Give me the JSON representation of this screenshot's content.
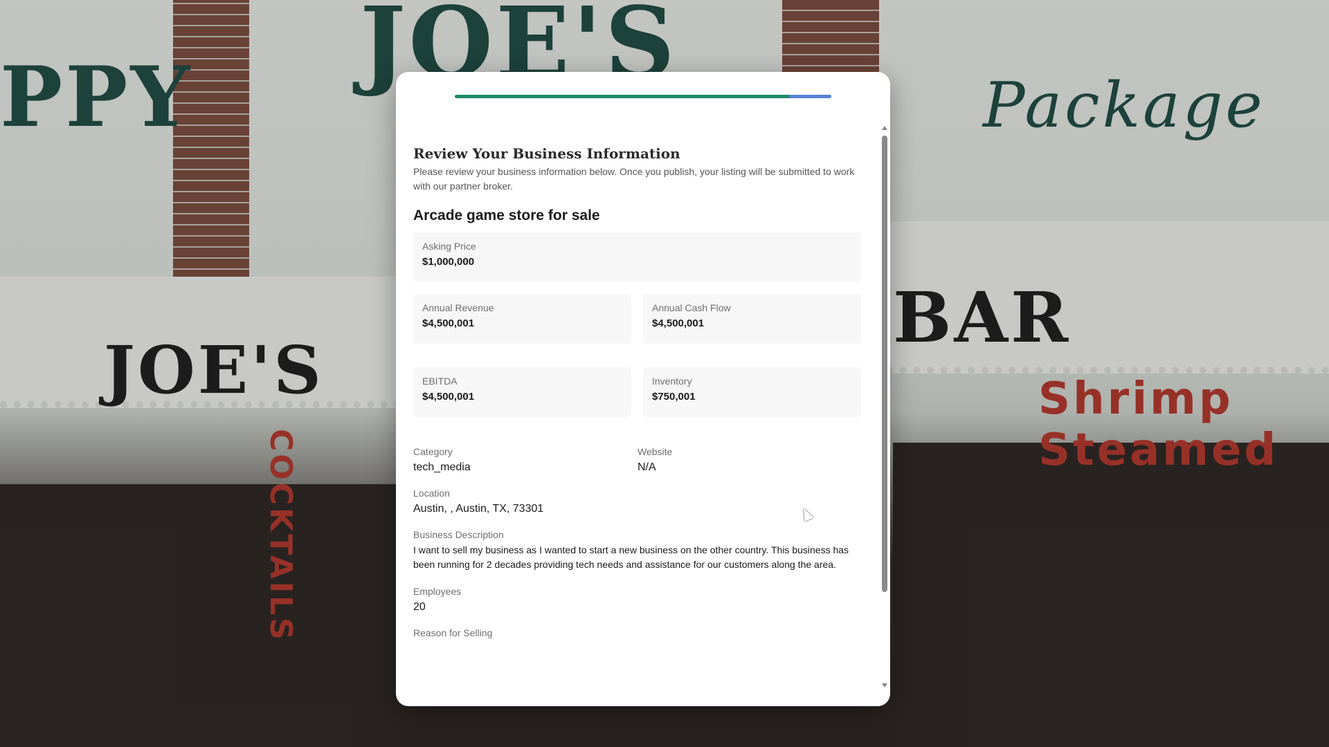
{
  "background": {
    "signs": [
      "PPY",
      "JOE'S",
      "Package",
      "JOE'S",
      "BAR",
      "Shrimp Steamed",
      "COCKTAILS"
    ]
  },
  "modal": {
    "progress_percent": 89,
    "heading": "Review Your Business Information",
    "subheading": "Please review your business information below. Once you publish, your listing will be submitted to work with our partner broker.",
    "listing_title": "Arcade game store for sale",
    "asking_price": {
      "label": "Asking Price",
      "value": "$1,000,000"
    },
    "annual_revenue": {
      "label": "Annual Revenue",
      "value": "$4,500,001"
    },
    "annual_cash_flow": {
      "label": "Annual Cash Flow",
      "value": "$4,500,001"
    },
    "ebitda": {
      "label": "EBITDA",
      "value": "$4,500,001"
    },
    "inventory": {
      "label": "Inventory",
      "value": "$750,001"
    },
    "category": {
      "label": "Category",
      "value": "tech_media"
    },
    "website": {
      "label": "Website",
      "value": "N/A"
    },
    "location": {
      "label": "Location",
      "value": "Austin, , Austin, TX, 73301"
    },
    "description": {
      "label": "Business Description",
      "value": "I want to sell my business as I wanted to start a new business on the other country. This business has been running for 2 decades providing tech needs and assistance for our customers along the area."
    },
    "employees": {
      "label": "Employees",
      "value": "20"
    },
    "reason": {
      "label": "Reason for Selling"
    }
  },
  "colors": {
    "progress_complete": "#1f8a6a",
    "progress_remaining": "#5a82d6"
  }
}
